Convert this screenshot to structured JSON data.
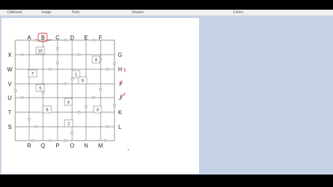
{
  "ribbon": {
    "groups": [
      {
        "label": "Clipboard"
      },
      {
        "label": "Image"
      },
      {
        "label": "Tools"
      },
      {
        "label": "Shapes"
      },
      {
        "label": "Colors"
      }
    ]
  },
  "puzzle": {
    "top_letters": [
      "A",
      "B",
      "C",
      "D",
      "E",
      "F"
    ],
    "bottom_letters": [
      "R",
      "Q",
      "P",
      "O",
      "N",
      "M"
    ],
    "left_letters": [
      "X",
      "W",
      "V",
      "U",
      "T",
      "S"
    ],
    "right_letters": [
      "G",
      "H",
      "I",
      "J",
      "K",
      "L"
    ],
    "numbered_boxes": [
      "10",
      "8",
      "7",
      "1",
      "9",
      "5",
      "4",
      "6",
      "3",
      "2"
    ]
  },
  "colors": {
    "annotation": "#d03030",
    "grid": "#777777"
  }
}
